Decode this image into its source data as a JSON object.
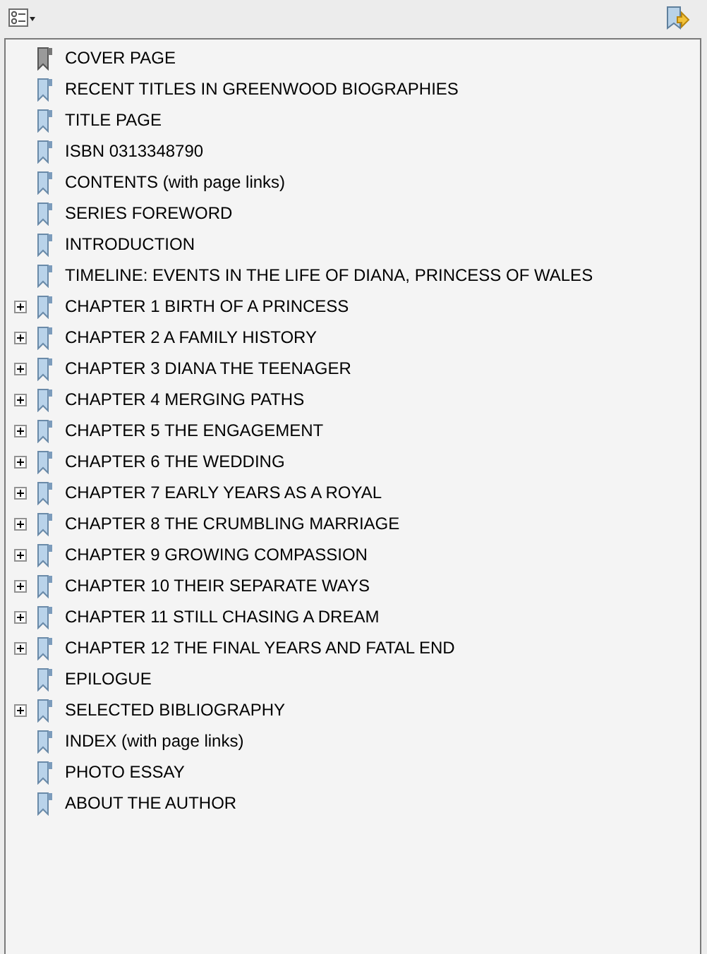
{
  "bookmarks": [
    {
      "label": "COVER PAGE",
      "selected": true,
      "expandable": false
    },
    {
      "label": "RECENT TITLES IN GREENWOOD BIOGRAPHIES",
      "selected": false,
      "expandable": false
    },
    {
      "label": "TITLE PAGE",
      "selected": false,
      "expandable": false
    },
    {
      "label": "ISBN 0313348790",
      "selected": false,
      "expandable": false
    },
    {
      "label": "CONTENTS (with page links)",
      "selected": false,
      "expandable": false
    },
    {
      "label": "SERIES FOREWORD",
      "selected": false,
      "expandable": false
    },
    {
      "label": "INTRODUCTION",
      "selected": false,
      "expandable": false
    },
    {
      "label": "TIMELINE: EVENTS IN THE LIFE OF DIANA, PRINCESS OF WALES",
      "selected": false,
      "expandable": false
    },
    {
      "label": "CHAPTER 1 BIRTH OF A PRINCESS",
      "selected": false,
      "expandable": true
    },
    {
      "label": "CHAPTER 2 A FAMILY HISTORY",
      "selected": false,
      "expandable": true
    },
    {
      "label": "CHAPTER 3 DIANA THE TEENAGER",
      "selected": false,
      "expandable": true
    },
    {
      "label": "CHAPTER 4 MERGING PATHS",
      "selected": false,
      "expandable": true
    },
    {
      "label": "CHAPTER 5 THE ENGAGEMENT",
      "selected": false,
      "expandable": true
    },
    {
      "label": "CHAPTER 6 THE WEDDING",
      "selected": false,
      "expandable": true
    },
    {
      "label": "CHAPTER 7 EARLY YEARS AS A ROYAL",
      "selected": false,
      "expandable": true
    },
    {
      "label": "CHAPTER 8 THE CRUMBLING MARRIAGE",
      "selected": false,
      "expandable": true
    },
    {
      "label": "CHAPTER 9 GROWING COMPASSION",
      "selected": false,
      "expandable": true
    },
    {
      "label": "CHAPTER 10 THEIR SEPARATE WAYS",
      "selected": false,
      "expandable": true
    },
    {
      "label": "CHAPTER 11 STILL CHASING A DREAM",
      "selected": false,
      "expandable": true
    },
    {
      "label": "CHAPTER 12 THE FINAL YEARS AND FATAL END",
      "selected": false,
      "expandable": true
    },
    {
      "label": "EPILOGUE",
      "selected": false,
      "expandable": false
    },
    {
      "label": "SELECTED BIBLIOGRAPHY",
      "selected": false,
      "expandable": true
    },
    {
      "label": "INDEX (with page links)",
      "selected": false,
      "expandable": false
    },
    {
      "label": "PHOTO ESSAY",
      "selected": false,
      "expandable": false
    },
    {
      "label": "ABOUT THE AUTHOR",
      "selected": false,
      "expandable": false
    }
  ]
}
